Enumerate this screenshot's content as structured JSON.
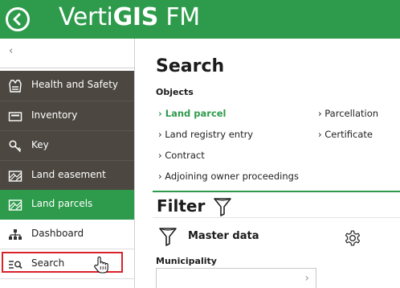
{
  "header": {
    "back_label": "Back",
    "brand_part1": "Verti",
    "brand_part2": "GIS",
    "brand_part3": " FM",
    "bg_color": "#2e9b4c"
  },
  "sidebar": {
    "collapse_glyph": "‹",
    "items": [
      {
        "label": "Health and Safety",
        "icon": "safety-vest-icon"
      },
      {
        "label": "Inventory",
        "icon": "inventory-card-icon"
      },
      {
        "label": "Key",
        "icon": "key-icon"
      },
      {
        "label": "Land easement",
        "icon": "map-icon"
      },
      {
        "label": "Land parcels",
        "icon": "map-icon",
        "active": true
      },
      {
        "label": "Dashboard",
        "icon": "hierarchy-icon"
      },
      {
        "label": "Search",
        "icon": "list-search-icon",
        "highlighted": true
      }
    ]
  },
  "main": {
    "title": "Search",
    "objects_label": "Objects",
    "links_left": [
      "Land parcel",
      "Land registry entry",
      "Contract",
      "Adjoining owner proceedings"
    ],
    "links_right": [
      "Parcellation",
      "Certificate"
    ],
    "link_prefix": "›",
    "filter_title": "Filter",
    "master_data_label": "Master data",
    "municipality_label": "Municipality",
    "field_chevron": "›"
  }
}
